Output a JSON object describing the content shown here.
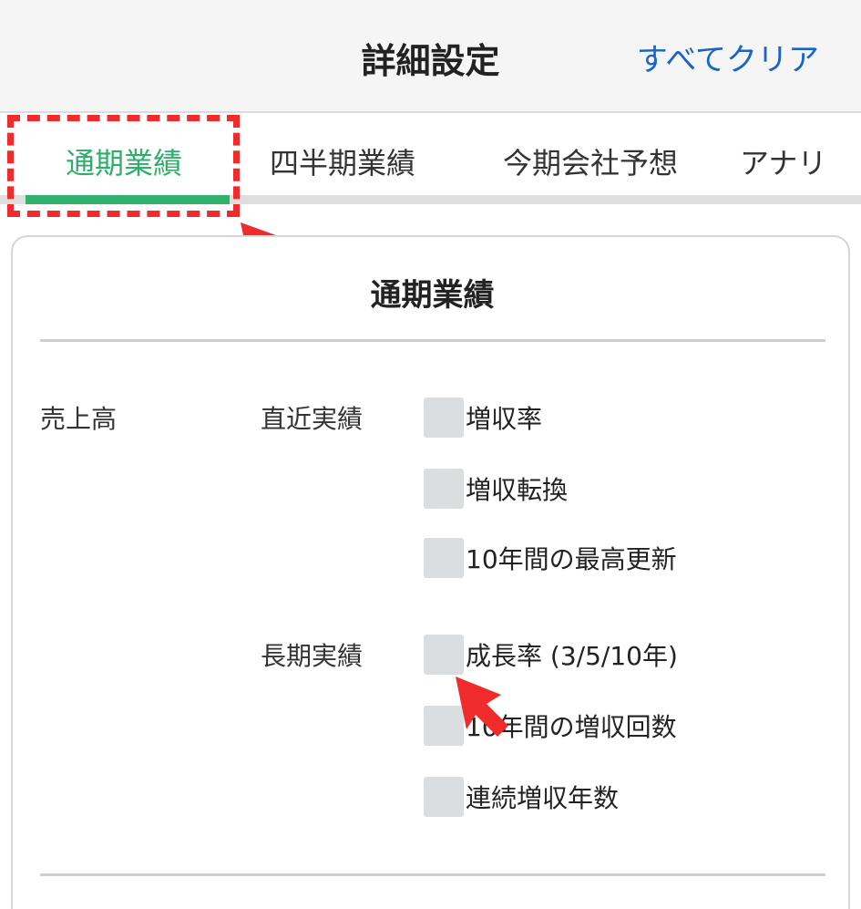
{
  "header": {
    "title": "詳細設定",
    "clear_all": "すべてクリア"
  },
  "tabs": [
    {
      "label": "通期業績",
      "active": true
    },
    {
      "label": "四半期業績",
      "active": false
    },
    {
      "label": "今期会社予想",
      "active": false
    },
    {
      "label": "アナリ",
      "active": false
    }
  ],
  "section": {
    "title": "通期業績",
    "category": "売上高",
    "groups": [
      {
        "label": "直近実績",
        "options": [
          {
            "label": "増収率",
            "checked": false
          },
          {
            "label": "増収転換",
            "checked": false
          },
          {
            "label": "10年間の最高更新",
            "checked": false
          }
        ]
      },
      {
        "label": "長期実績",
        "options": [
          {
            "label": "成長率 (3/5/10年)",
            "checked": false
          },
          {
            "label": "10年間の増収回数",
            "checked": false
          },
          {
            "label": "連続増収年数",
            "checked": false
          }
        ]
      }
    ]
  },
  "colors": {
    "accent_green": "#2fb26c",
    "link_blue": "#1a63c7",
    "annotation_red": "#f02b2b"
  }
}
